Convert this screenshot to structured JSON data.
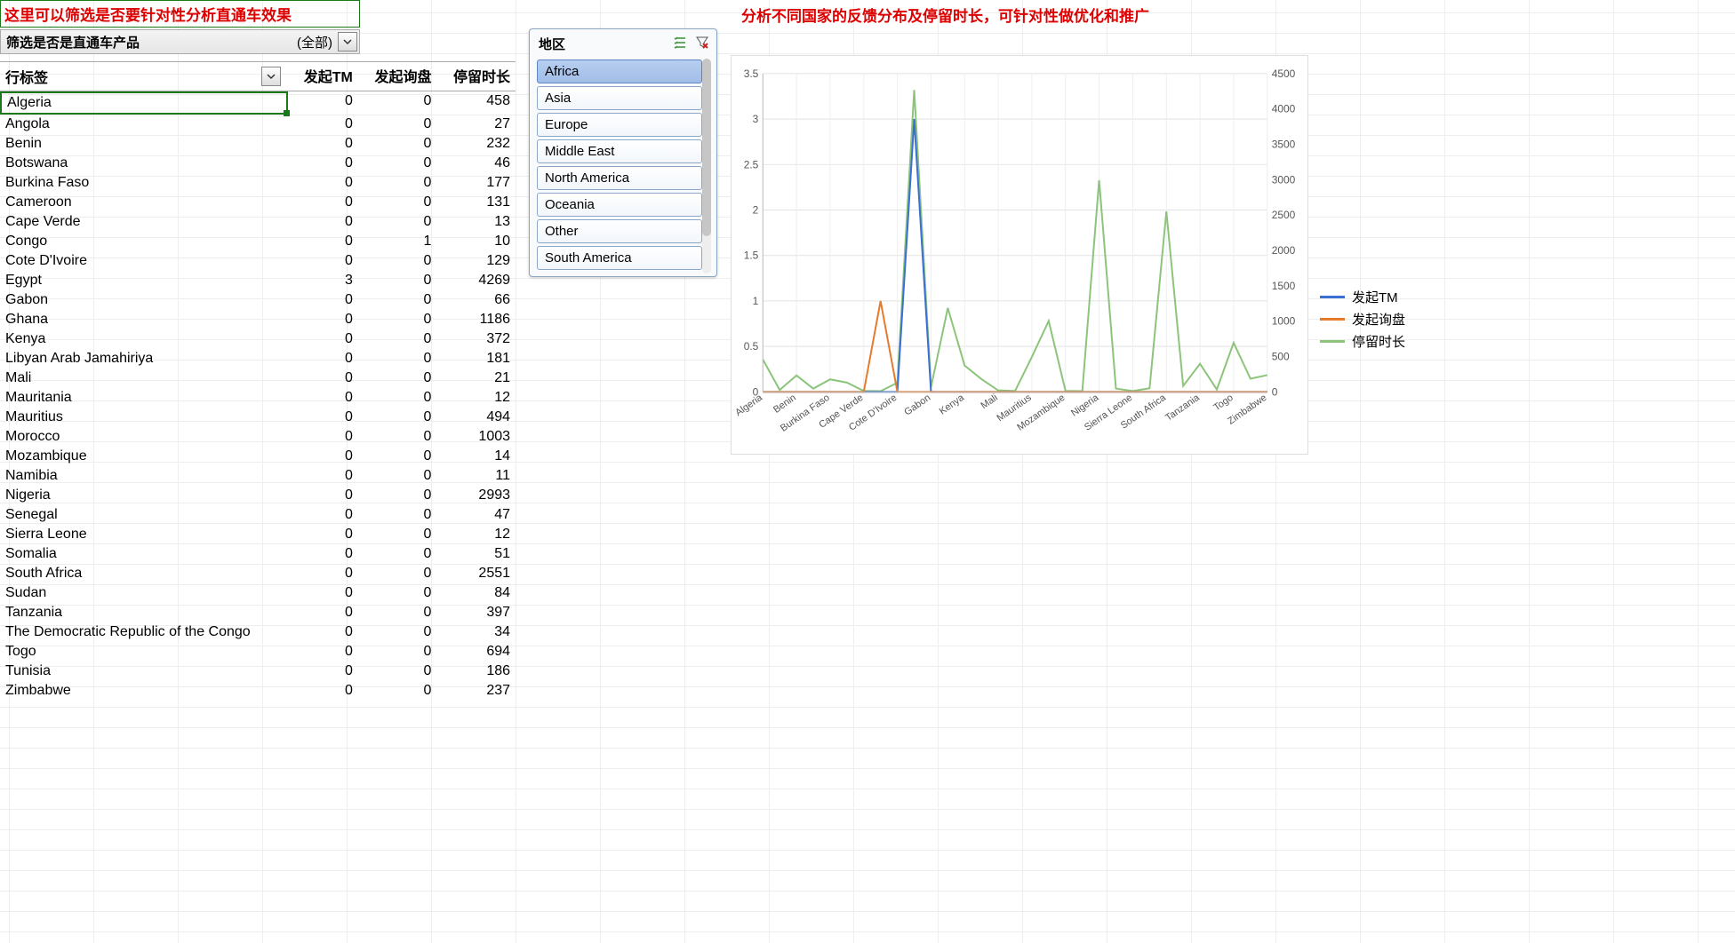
{
  "notes": {
    "left": "这里可以筛选是否要针对性分析直通车效果",
    "right": "分析不同国家的反馈分布及停留时长，可针对性做优化和推广"
  },
  "filter": {
    "label": "筛选是否是直通车产品",
    "value": "(全部)"
  },
  "columns": {
    "category": "行标签",
    "tm": "发起TM",
    "inquiry": "发起询盘",
    "stay": "停留时长"
  },
  "rows": [
    {
      "country": "Algeria",
      "tm": 0,
      "inq": 0,
      "stay": 458,
      "selected": true
    },
    {
      "country": "Angola",
      "tm": 0,
      "inq": 0,
      "stay": 27
    },
    {
      "country": "Benin",
      "tm": 0,
      "inq": 0,
      "stay": 232
    },
    {
      "country": "Botswana",
      "tm": 0,
      "inq": 0,
      "stay": 46
    },
    {
      "country": "Burkina Faso",
      "tm": 0,
      "inq": 0,
      "stay": 177
    },
    {
      "country": "Cameroon",
      "tm": 0,
      "inq": 0,
      "stay": 131
    },
    {
      "country": "Cape Verde",
      "tm": 0,
      "inq": 0,
      "stay": 13
    },
    {
      "country": "Congo",
      "tm": 0,
      "inq": 1,
      "stay": 10
    },
    {
      "country": "Cote D'Ivoire",
      "tm": 0,
      "inq": 0,
      "stay": 129
    },
    {
      "country": "Egypt",
      "tm": 3,
      "inq": 0,
      "stay": 4269
    },
    {
      "country": "Gabon",
      "tm": 0,
      "inq": 0,
      "stay": 66
    },
    {
      "country": "Ghana",
      "tm": 0,
      "inq": 0,
      "stay": 1186
    },
    {
      "country": "Kenya",
      "tm": 0,
      "inq": 0,
      "stay": 372
    },
    {
      "country": "Libyan Arab Jamahiriya",
      "tm": 0,
      "inq": 0,
      "stay": 181
    },
    {
      "country": "Mali",
      "tm": 0,
      "inq": 0,
      "stay": 21
    },
    {
      "country": "Mauritania",
      "tm": 0,
      "inq": 0,
      "stay": 12
    },
    {
      "country": "Mauritius",
      "tm": 0,
      "inq": 0,
      "stay": 494
    },
    {
      "country": "Morocco",
      "tm": 0,
      "inq": 0,
      "stay": 1003
    },
    {
      "country": "Mozambique",
      "tm": 0,
      "inq": 0,
      "stay": 14
    },
    {
      "country": "Namibia",
      "tm": 0,
      "inq": 0,
      "stay": 11
    },
    {
      "country": "Nigeria",
      "tm": 0,
      "inq": 0,
      "stay": 2993
    },
    {
      "country": "Senegal",
      "tm": 0,
      "inq": 0,
      "stay": 47
    },
    {
      "country": "Sierra Leone",
      "tm": 0,
      "inq": 0,
      "stay": 12
    },
    {
      "country": "Somalia",
      "tm": 0,
      "inq": 0,
      "stay": 51
    },
    {
      "country": "South Africa",
      "tm": 0,
      "inq": 0,
      "stay": 2551
    },
    {
      "country": "Sudan",
      "tm": 0,
      "inq": 0,
      "stay": 84
    },
    {
      "country": "Tanzania",
      "tm": 0,
      "inq": 0,
      "stay": 397
    },
    {
      "country": "The Democratic Republic of the Congo",
      "tm": 0,
      "inq": 0,
      "stay": 34
    },
    {
      "country": "Togo",
      "tm": 0,
      "inq": 0,
      "stay": 694
    },
    {
      "country": "Tunisia",
      "tm": 0,
      "inq": 0,
      "stay": 186
    },
    {
      "country": "Zimbabwe",
      "tm": 0,
      "inq": 0,
      "stay": 237
    }
  ],
  "slicer": {
    "title": "地区",
    "items": [
      "Africa",
      "Asia",
      "Europe",
      "Middle East",
      "North America",
      "Oceania",
      "Other",
      "South America"
    ],
    "selected": "Africa"
  },
  "legend": {
    "tm": "发起TM",
    "inq": "发起询盘",
    "stay": "停留时长"
  },
  "colors": {
    "tm": "#3b6fd3",
    "inq": "#e57a2a",
    "stay": "#8bc47a"
  },
  "chart_data": {
    "type": "line",
    "x": [
      "Algeria",
      "Benin",
      "Burkina Faso",
      "Cape Verde",
      "Cote D'Ivoire",
      "Gabon",
      "Kenya",
      "Mali",
      "Mauritius",
      "Mozambique",
      "Nigeria",
      "Sierra Leone",
      "South Africa",
      "Tanzania",
      "Togo",
      "Zimbabwe"
    ],
    "left_axis_range": [
      0,
      3.5
    ],
    "left_ticks": [
      0,
      0.5,
      1,
      1.5,
      2,
      2.5,
      3,
      3.5
    ],
    "right_axis_range": [
      0,
      4500
    ],
    "right_ticks": [
      0,
      500,
      1000,
      1500,
      2000,
      2500,
      3000,
      3500,
      4000,
      4500
    ],
    "series": [
      {
        "name": "发起TM",
        "axis": "left",
        "color": "#3b6fd3",
        "points": {
          "Algeria": 0,
          "Benin": 0,
          "Burkina Faso": 0,
          "Cape Verde": 0,
          "Cote D'Ivoire": 0,
          "Egypt_between": 3,
          "Gabon": 0,
          "Kenya": 0,
          "Mali": 0,
          "Mauritius": 0,
          "Mozambique": 0,
          "Nigeria": 0,
          "Sierra Leone": 0,
          "South Africa": 0,
          "Tanzania": 0,
          "Togo": 0,
          "Zimbabwe": 0
        }
      },
      {
        "name": "发起询盘",
        "axis": "left",
        "color": "#e57a2a",
        "points": {
          "Algeria": 0,
          "Benin": 0,
          "Burkina Faso": 0,
          "Cape Verde": 0,
          "Congo_between": 1,
          "Cote D'Ivoire": 0,
          "Gabon": 0,
          "Kenya": 0,
          "Mali": 0,
          "Mauritius": 0,
          "Mozambique": 0,
          "Nigeria": 0,
          "Sierra Leone": 0,
          "South Africa": 0,
          "Tanzania": 0,
          "Togo": 0,
          "Zimbabwe": 0
        }
      },
      {
        "name": "停留时长",
        "axis": "right",
        "color": "#8bc47a",
        "points": {
          "Algeria": 458,
          "Benin": 232,
          "Burkina Faso": 177,
          "Cape Verde": 13,
          "Cote D'Ivoire": 129,
          "Egypt_between": 4269,
          "Gabon": 66,
          "Ghana_between": 1186,
          "Kenya": 372,
          "Mali": 21,
          "Mauritius": 494,
          "Morocco_between": 1003,
          "Mozambique": 14,
          "Nigeria": 2993,
          "Sierra Leone": 12,
          "South Africa": 2551,
          "Tanzania": 397,
          "Togo": 694,
          "Zimbabwe": 237
        }
      }
    ]
  }
}
